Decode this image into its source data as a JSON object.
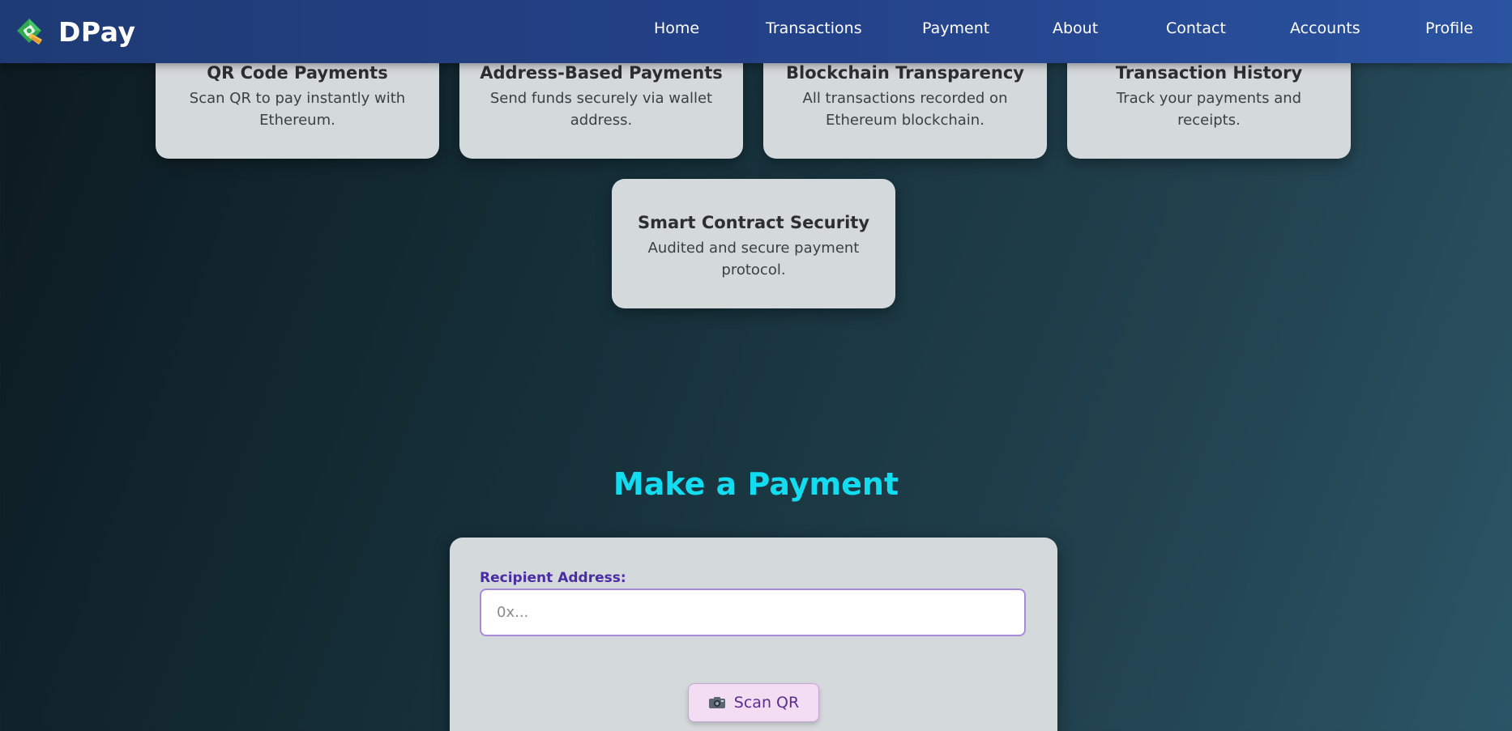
{
  "brand": {
    "name": "DPay",
    "logo_icon": "money-diamond-icon"
  },
  "nav": {
    "items": [
      {
        "label": "Home"
      },
      {
        "label": "Transactions"
      },
      {
        "label": "Payment"
      },
      {
        "label": "About"
      },
      {
        "label": "Contact"
      },
      {
        "label": "Accounts"
      },
      {
        "label": "Profile"
      }
    ]
  },
  "features": [
    {
      "title": "QR Code Payments",
      "description": "Scan QR to pay instantly with Ethereum."
    },
    {
      "title": "Address-Based Payments",
      "description": "Send funds securely via wallet address."
    },
    {
      "title": "Blockchain Transparency",
      "description": "All transactions recorded on Ethereum blockchain."
    },
    {
      "title": "Transaction History",
      "description": "Track your payments and receipts."
    },
    {
      "title": "Smart Contract Security",
      "description": "Audited and secure payment protocol."
    }
  ],
  "payment": {
    "title": "Make a Payment",
    "recipient_label": "Recipient Address:",
    "recipient_placeholder": "0x...",
    "recipient_value": "",
    "scan_button_label": "Scan QR",
    "scan_icon": "camera-icon"
  },
  "colors": {
    "navbar": "#24428a",
    "accent_title": "#12dcef",
    "label": "#4a2ca3",
    "card_bg": "#d4d9dc",
    "scan_button_bg": "#f3ddf3"
  }
}
